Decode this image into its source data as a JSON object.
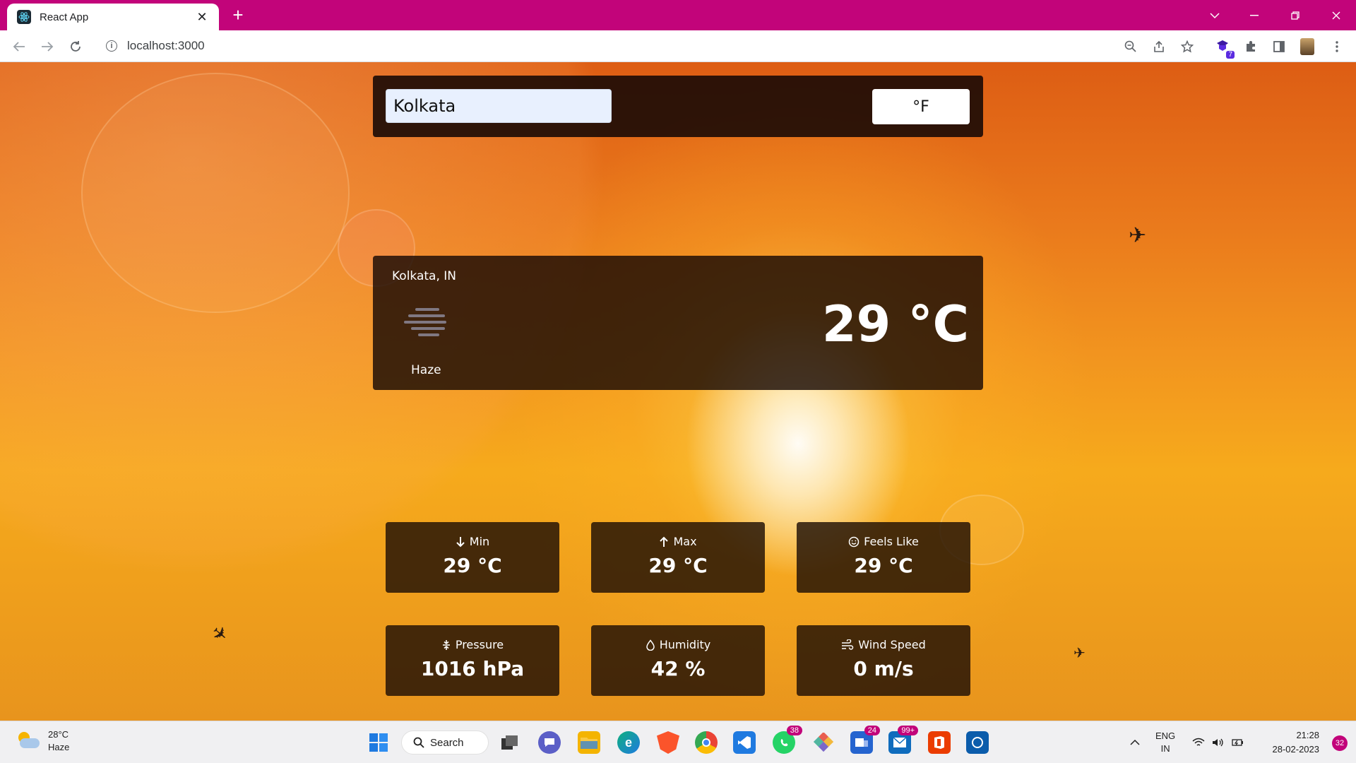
{
  "browser": {
    "tab_title": "React App",
    "url": "localhost:3000",
    "accent_color": "#c2047a",
    "extension_badge": "7"
  },
  "search": {
    "city_value": "Kolkata",
    "unit_button_label": "°F"
  },
  "weather": {
    "location": "Kolkata, IN",
    "condition": "Haze",
    "temperature": "29 °C",
    "icon": "haze-icon"
  },
  "stats": [
    {
      "label": "Min",
      "value": "29 °C",
      "icon": "arrow-down-icon"
    },
    {
      "label": "Max",
      "value": "29 °C",
      "icon": "arrow-up-icon"
    },
    {
      "label": "Feels Like",
      "value": "29 °C",
      "icon": "smile-icon"
    },
    {
      "label": "Pressure",
      "value": "1016 hPa",
      "icon": "compress-icon"
    },
    {
      "label": "Humidity",
      "value": "42 %",
      "icon": "droplet-icon"
    },
    {
      "label": "Wind Speed",
      "value": "0 m/s",
      "icon": "wind-icon"
    }
  ],
  "taskbar": {
    "weather_temp": "28°C",
    "weather_condition": "Haze",
    "search_label": "Search",
    "whatsapp_badge": "38",
    "teams_badge": "24",
    "mail_badge": "99+",
    "language": "ENG",
    "region": "IN",
    "time": "21:28",
    "date": "28-02-2023",
    "notifications": "32"
  }
}
